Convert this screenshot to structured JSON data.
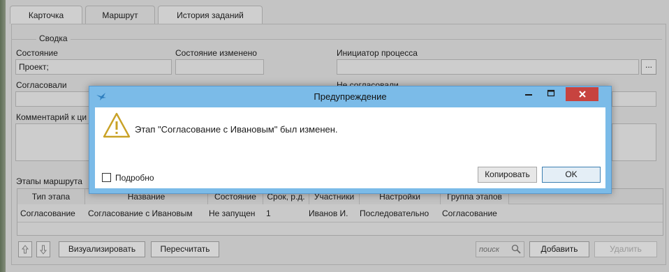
{
  "tabs": [
    {
      "label": "Карточка"
    },
    {
      "label": "Маршрут"
    },
    {
      "label": "История заданий"
    }
  ],
  "summary": {
    "group_title": "Сводка",
    "state_label": "Состояние",
    "state_value": "Проект;",
    "state_changed_label": "Состояние изменено",
    "state_changed_value": "",
    "initiator_label": "Инициатор процесса",
    "initiator_value": "",
    "initiator_browse": "...",
    "approved_label": "Согласовали",
    "not_approved_label": "Не согласовали",
    "comment_label": "Комментарий к ци"
  },
  "stages": {
    "label": "Этапы маршрута",
    "columns": [
      "Тип этапа",
      "Название",
      "Состояние",
      "Срок, р.д.",
      "Участники",
      "Настройки",
      "Группа этапов"
    ],
    "rows": [
      [
        "Согласование",
        "Согласование с Ивановым",
        "Не запущен",
        "1",
        "Иванов И.",
        "Последовательно",
        "Согласование"
      ]
    ]
  },
  "toolbar": {
    "visualize": "Визуализировать",
    "recalculate": "Пересчитать",
    "search_placeholder": "поиск",
    "add": "Добавить",
    "delete": "Удалить"
  },
  "dialog": {
    "title": "Предупреждение",
    "message": "Этап \"Согласование с Ивановым\"  был изменен.",
    "details_label": "Подробно",
    "copy_button": "Копировать",
    "ok_button": "OK"
  },
  "colors": {
    "titlebar": "#7bbbe8",
    "close": "#c7433f",
    "warning": "#c9a227"
  }
}
